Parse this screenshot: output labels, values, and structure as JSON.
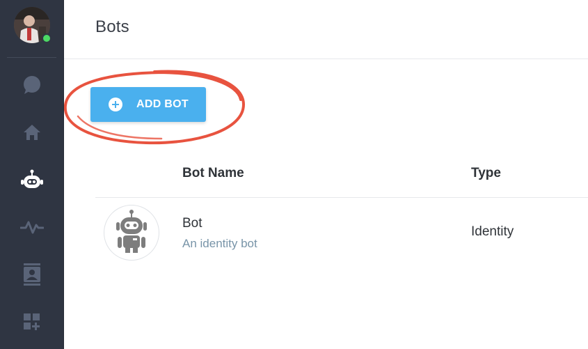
{
  "header": {
    "title": "Bots"
  },
  "toolbar": {
    "add_bot_label": "ADD BOT"
  },
  "table": {
    "columns": [
      "Bot Name",
      "Type"
    ],
    "rows": [
      {
        "name": "Bot",
        "description": "An identity bot",
        "type": "Identity"
      }
    ]
  },
  "sidebar": {
    "items": [
      {
        "icon": "chat-icon",
        "active": false
      },
      {
        "icon": "home-icon",
        "active": false
      },
      {
        "icon": "bot-icon",
        "active": true
      },
      {
        "icon": "activity-icon",
        "active": false
      },
      {
        "icon": "contacts-icon",
        "active": false
      },
      {
        "icon": "add-widget-icon",
        "active": false
      }
    ],
    "presence": "online"
  },
  "colors": {
    "sidebar_bg": "#2f3542",
    "accent": "#4ab0ee",
    "presence": "#4cd964",
    "highlight_ring": "#e8533f",
    "icon_inactive": "#5a6478",
    "icon_active": "#ffffff"
  }
}
